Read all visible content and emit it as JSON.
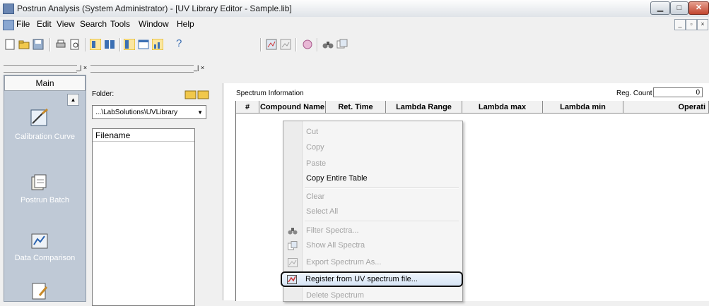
{
  "window": {
    "title": "Postrun Analysis (System Administrator) - [UV Library Editor - Sample.lib]"
  },
  "menu": [
    "File",
    "Edit",
    "View",
    "Search",
    "Tools",
    "Window",
    "Help"
  ],
  "left_nav": {
    "tab": "Main",
    "items": [
      {
        "label": "Calibration Curve",
        "icon": "calibration-curve-icon"
      },
      {
        "label": "Postrun Batch",
        "icon": "postrun-batch-icon"
      },
      {
        "label": "Data Comparison",
        "icon": "data-comparison-icon"
      },
      {
        "label": "",
        "icon": "report-icon"
      }
    ]
  },
  "folder": {
    "label": "Folder:",
    "path": "...\\LabSolutions\\UVLibrary",
    "list_header": "Filename"
  },
  "spectrum": {
    "title": "Spectrum Information",
    "reg_count_label": "Reg. Count",
    "reg_count_value": "0",
    "columns": [
      "#",
      "Compound Name",
      "Ret. Time",
      "Lambda Range",
      "Lambda max",
      "Lambda min",
      "Operati"
    ]
  },
  "context_menu": {
    "items": [
      {
        "label": "Cut",
        "enabled": false
      },
      {
        "label": "Copy",
        "enabled": false
      },
      {
        "label": "Paste",
        "enabled": false
      },
      {
        "label": "Copy Entire Table",
        "enabled": true
      },
      {
        "label": "Clear",
        "enabled": false
      },
      {
        "label": "Select All",
        "enabled": false
      },
      {
        "label": "Filter Spectra...",
        "enabled": false,
        "icon": "binoculars-icon"
      },
      {
        "label": "Show All Spectra",
        "enabled": false,
        "icon": "show-all-icon"
      },
      {
        "label": "Export Spectrum As...",
        "enabled": false,
        "icon": "export-icon"
      },
      {
        "label": "Register from UV spectrum file...",
        "enabled": true,
        "icon": "register-icon",
        "highlighted": true
      },
      {
        "label": "Delete Spectrum",
        "enabled": false
      }
    ]
  },
  "colors": {
    "nav_bg": "#bfc9d6",
    "highlight_border": "#111111",
    "close_btn": "#c2452f"
  }
}
